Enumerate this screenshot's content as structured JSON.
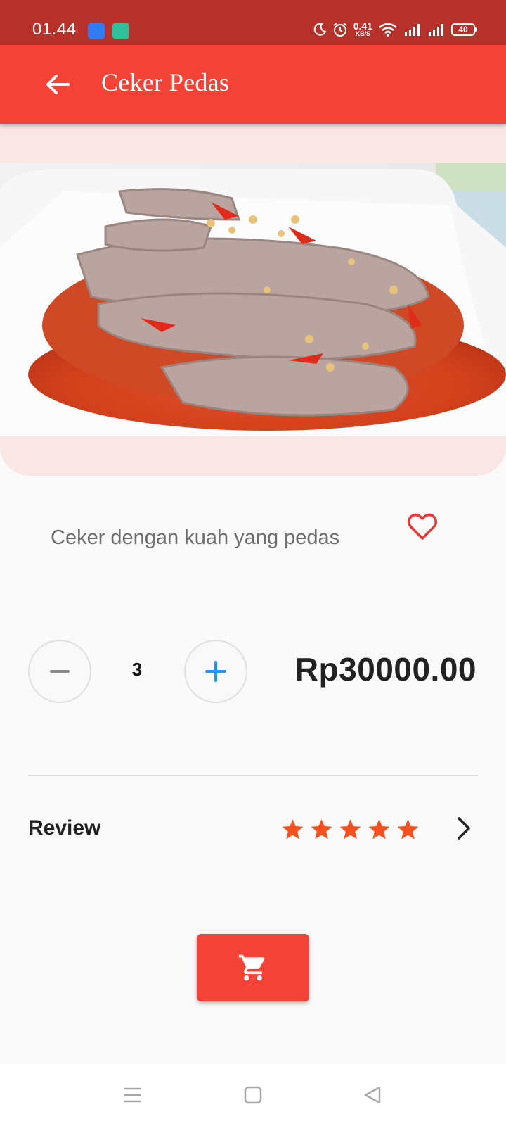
{
  "status_bar": {
    "time": "01.44",
    "speed_value": "0.41",
    "speed_unit": "KB/S",
    "battery": "40"
  },
  "app_bar": {
    "title": "Ceker Pedas",
    "back_icon": "arrow-back-icon"
  },
  "product": {
    "image_icon": "food-photo",
    "description": "Ceker dengan kuah yang pedas",
    "favorite_icon": "heart-outline-icon"
  },
  "quantity": {
    "minus_icon": "minus-icon",
    "value": "3",
    "plus_icon": "plus-icon"
  },
  "price": "Rp30000.00",
  "review": {
    "label": "Review",
    "rating": 5,
    "max_rating": 5,
    "chevron_icon": "chevron-right-icon"
  },
  "cart_button": {
    "icon": "shopping-cart-icon"
  },
  "nav_bar": {
    "items": [
      "menu-icon",
      "home-square-icon",
      "back-triangle-icon"
    ]
  },
  "colors": {
    "status_bar": "#b7312a",
    "app_bar": "#f44336",
    "image_panel_bg": "#fae6e5",
    "accent_blue": "#2196f3",
    "star": "#f4511e"
  }
}
